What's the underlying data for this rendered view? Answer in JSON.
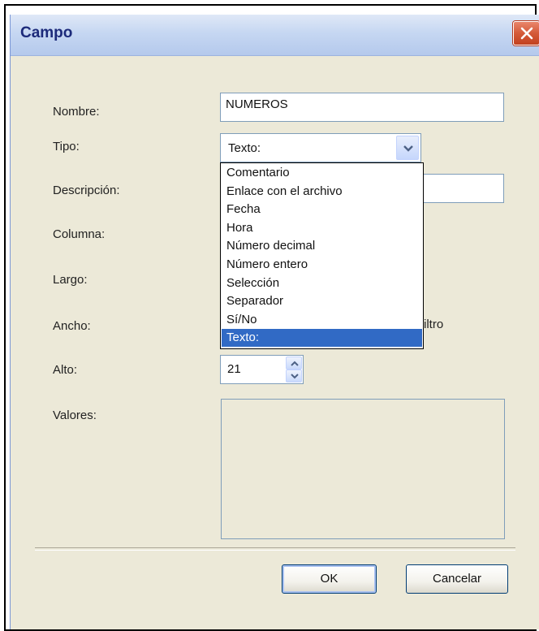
{
  "window": {
    "title": "Campo",
    "close_icon": "close-icon"
  },
  "form": {
    "nombre_label": "Nombre:",
    "nombre_value": "NUMEROS",
    "tipo_label": "Tipo:",
    "tipo_value": "Texto:",
    "descripcion_label": "Descripción:",
    "descripcion_value": "",
    "columna_label": "Columna:",
    "largo_label": "Largo:",
    "ancho_label": "Ancho:",
    "filtro_partial": "iltro",
    "alto_label": "Alto:",
    "alto_value": "21",
    "valores_label": "Valores:"
  },
  "dropdown": {
    "items": [
      {
        "label": "Comentario",
        "selected": false
      },
      {
        "label": "Enlace con el archivo",
        "selected": false
      },
      {
        "label": "Fecha",
        "selected": false
      },
      {
        "label": "Hora",
        "selected": false
      },
      {
        "label": "Número decimal",
        "selected": false
      },
      {
        "label": "Número entero",
        "selected": false
      },
      {
        "label": "Selección",
        "selected": false
      },
      {
        "label": "Separador",
        "selected": false
      },
      {
        "label": "Sí/No",
        "selected": false
      },
      {
        "label": "Texto:",
        "selected": true
      }
    ]
  },
  "buttons": {
    "ok_label": "OK",
    "cancel_label": "Cancelar"
  },
  "colors": {
    "dialog_bg": "#ece9d8",
    "selection": "#316ac5",
    "title_text": "#1c2a7a",
    "close_button": "#d45a39"
  }
}
